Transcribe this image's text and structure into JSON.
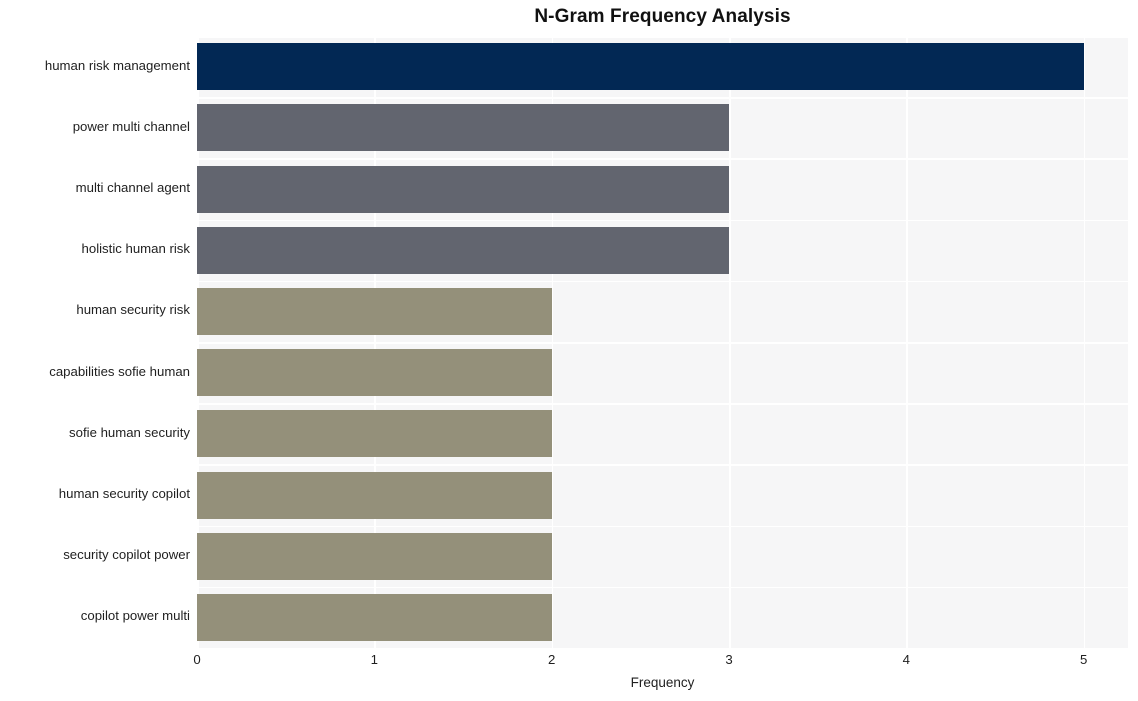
{
  "chart_data": {
    "type": "bar",
    "orientation": "horizontal",
    "title": "N-Gram Frequency Analysis",
    "xlabel": "Frequency",
    "ylabel": "",
    "categories": [
      "human risk management",
      "power multi channel",
      "multi channel agent",
      "holistic human risk",
      "human security risk",
      "capabilities sofie human",
      "sofie human security",
      "human security copilot",
      "security copilot power",
      "copilot power multi"
    ],
    "values": [
      5,
      3,
      3,
      3,
      2,
      2,
      2,
      2,
      2,
      2
    ],
    "bar_colors": [
      "#022854",
      "#62656f",
      "#62656f",
      "#62656f",
      "#94907a",
      "#94907a",
      "#94907a",
      "#94907a",
      "#94907a",
      "#94907a"
    ],
    "xlim": [
      0,
      5.25
    ],
    "xticks": [
      0,
      1,
      2,
      3,
      4,
      5
    ],
    "xtick_labels": [
      "0",
      "1",
      "2",
      "3",
      "4",
      "5"
    ],
    "grid": true,
    "grid_color": "#ffffff",
    "plot_background": "#f6f6f7",
    "figure_background": "#ffffff",
    "legend": null
  }
}
